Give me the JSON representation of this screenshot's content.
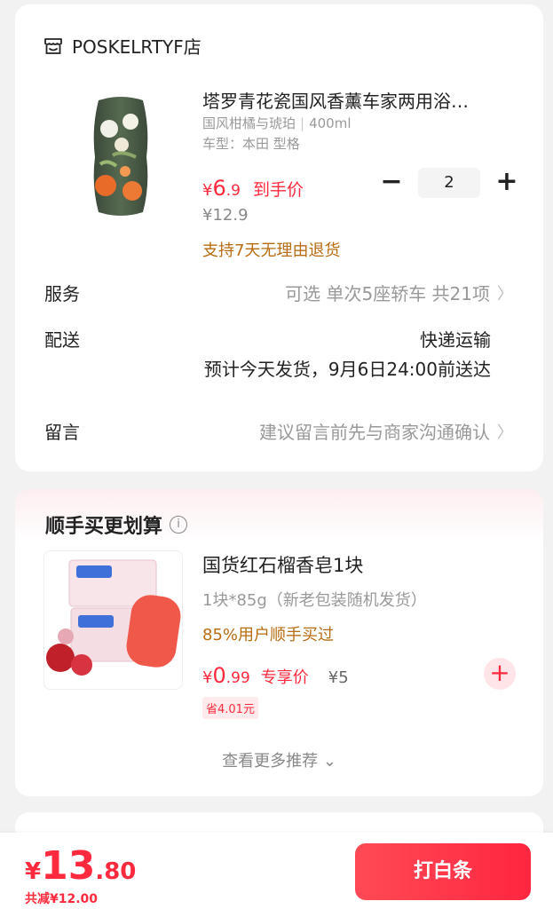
{
  "store": {
    "name": "POSKELRTYF店",
    "icon": "store-icon"
  },
  "product": {
    "title": "塔罗青花瓷国风香薰车家两用浴…",
    "spec_flavor": "国风柑橘与琥珀",
    "spec_volume": "400ml",
    "car_model": "车型：本田 型格",
    "currency": "¥",
    "price_int": "6",
    "price_dec": ".9",
    "price_tag": "到手价",
    "original_price": "¥12.9",
    "return_policy": "支持7天无理由退货",
    "quantity": "2"
  },
  "rows": {
    "service_label": "服务",
    "service_value": "可选 单次5座轿车 共21项",
    "delivery_label": "配送",
    "delivery_method": "快递运输",
    "delivery_eta": "预计今天发货，9月6日24:00前送达",
    "note_label": "留言",
    "note_placeholder": "建议留言前先与商家沟通确认"
  },
  "recommend": {
    "title": "顺手买更划算",
    "item_name": "国货红石榴香皂1块",
    "item_spec": "1块*85g（新老包装随机发货）",
    "item_buyers": "85%用户顺手买过",
    "currency": "¥",
    "price_int": "0",
    "price_dec": ".99",
    "price_tag": "专享价",
    "orig_price": "¥5",
    "save_badge": "省4.01元",
    "more_link": "查看更多推荐"
  },
  "bottom": {
    "currency": "¥",
    "total_int": "13",
    "total_dec": ".80",
    "total_save": "共减¥12.00",
    "pay_button": "打白条"
  },
  "colors": {
    "accent": "#ff2a3d",
    "policy": "#b86c10"
  }
}
